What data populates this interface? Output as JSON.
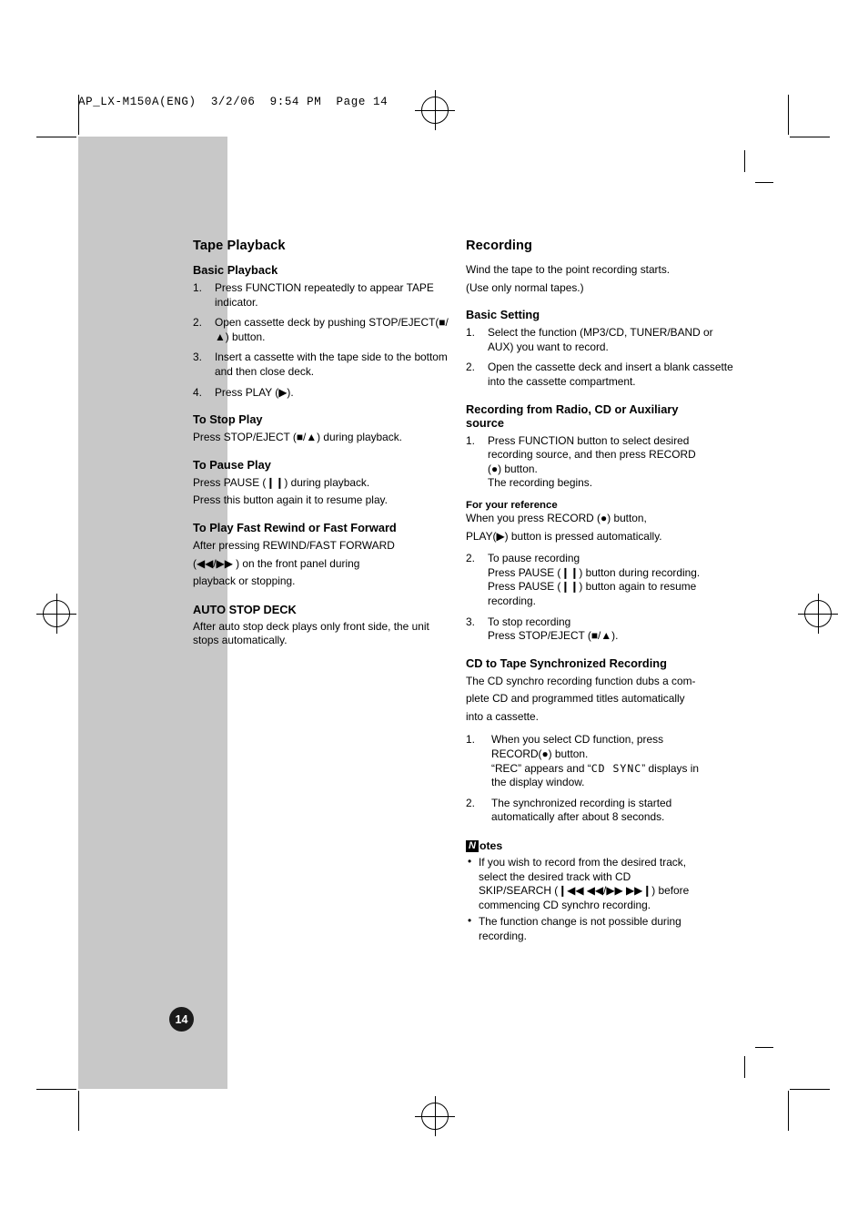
{
  "print_header": "AP_LX-M150A(ENG)  3/2/06  9:54 PM  Page 14",
  "page_number": "14",
  "left_column": {
    "section_title": "Tape Playback",
    "basic_playback": {
      "heading": "Basic Playback",
      "steps": [
        {
          "num": "1.",
          "text": "Press FUNCTION repeatedly to appear TAPE  indicator."
        },
        {
          "num": "2.",
          "text": "Open cassette deck by pushing STOP/EJECT(■/▲) button."
        },
        {
          "num": "3.",
          "text": "Insert a cassette with the tape side to the bottom and then close deck."
        },
        {
          "num": "4.",
          "text": "Press PLAY (▶)."
        }
      ]
    },
    "to_stop_play": {
      "heading": "To Stop Play",
      "text": "Press STOP/EJECT (■/▲) during playback."
    },
    "to_pause_play": {
      "heading": "To Pause Play",
      "text_1": "Press PAUSE (❙❙) during playback.",
      "text_2": "Press this button again it to resume play."
    },
    "fast_rewind": {
      "heading": "To Play Fast Rewind or Fast Forward",
      "text_1": "After pressing REWIND/FAST FORWARD",
      "text_2": "(◀◀/▶▶ ) on the front panel during",
      "text_3": "playback or stopping."
    },
    "auto_stop_deck": {
      "heading": "AUTO STOP DECK",
      "text": "After auto stop deck plays only front side, the unit stops automatically."
    }
  },
  "right_column": {
    "section_title": "Recording",
    "intro_1": "Wind the tape to the point recording starts.",
    "intro_2": "(Use only normal tapes.)",
    "basic_setting": {
      "heading": "Basic Setting",
      "steps": [
        {
          "num": "1.",
          "text": "Select the function (MP3/CD, TUNER/BAND or AUX) you want to record."
        },
        {
          "num": "2.",
          "text": "Open the cassette deck and insert a blank cassette into the cassette compartment."
        }
      ]
    },
    "recording_from": {
      "heading_line1": "Recording from Radio, CD or Auxiliary",
      "heading_line2": "source",
      "step1_num": "1.",
      "step1_line1": "Press FUNCTION button to select desired",
      "step1_line2": "recording source, and then press RECORD",
      "step1_line3": "(●) button.",
      "step1_line4": "The recording begins.",
      "for_your_reference": "For your reference",
      "fyr_line1": "When you press RECORD (●) button,",
      "fyr_line2": "PLAY(▶) button is pressed automatically.",
      "step2_num": "2.",
      "step2_line1": "To pause recording",
      "step2_line2": "Press PAUSE (❙❙) button during recording.",
      "step2_line3": "Press PAUSE (❙❙) button again to resume",
      "step2_line4": "recording.",
      "step3_num": "3.",
      "step3_line1": "To stop recording",
      "step3_line2": "Press STOP/EJECT (■/▲)."
    },
    "cd_sync": {
      "heading": "CD to Tape Synchronized Recording",
      "para_1": "The CD synchro recording function dubs a com-",
      "para_2": "plete CD and programmed titles automatically",
      "para_3": "into a cassette.",
      "step1_num": "1.",
      "step1_line1": "When you select CD function, press",
      "step1_line2": "RECORD(●) button.",
      "step1_line3_a": "“REC” appears and “",
      "step1_lcd": "CD SYNC",
      "step1_line3_b": "” displays  in",
      "step1_line4": "the display window.",
      "step2_num": "2.",
      "step2_line1": "The synchronized recording is started",
      "step2_line2": "automatically after about 8 seconds."
    },
    "notes": {
      "badge": "N",
      "word": "otes",
      "items": [
        {
          "line1": "If you wish to record from the desired track,",
          "line2": "select the desired track with CD",
          "line3": "SKIP/SEARCH (❙◀◀ ◀◀/▶▶ ▶▶❙) before",
          "line4": "commencing CD synchro recording."
        },
        {
          "line1": "The function change is not possible during",
          "line2": "recording."
        }
      ]
    }
  }
}
